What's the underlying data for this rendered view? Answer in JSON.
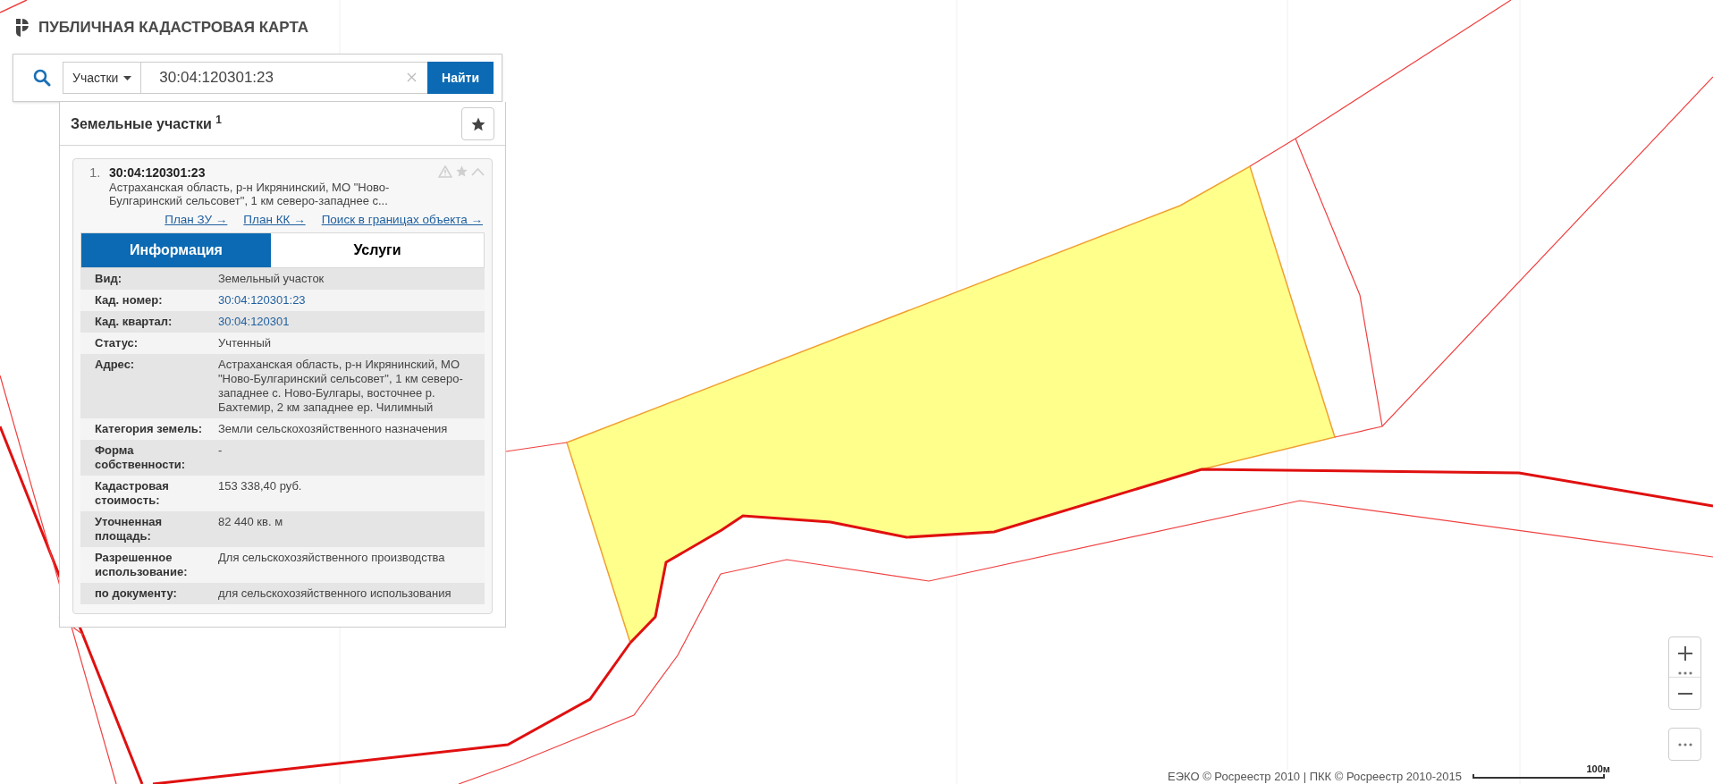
{
  "header": {
    "title": "ПУБЛИЧНАЯ КАДАСТРОВАЯ КАРТА"
  },
  "search": {
    "category": "Участки",
    "value": "30:04:120301:23",
    "button": "Найти"
  },
  "results": {
    "title": "Земельные участки $^{1}$",
    "items": [
      {
        "index": "1.",
        "number": "30:04:120301:23",
        "address": "Астраханская область, р-н Икрянинский, МО \"Ново-Булгаринский сельсовет\", 1 км северо-западнее с...",
        "links": [
          "План ЗУ →",
          "План КК →",
          "Поиск в границах объекта →"
        ],
        "tabs": [
          {
            "label": "Информация",
            "selected": true
          },
          {
            "label": "Услуги",
            "selected": false
          }
        ],
        "rows": [
          {
            "label": "Вид:",
            "value": "Земельный участок",
            "kind": "text"
          },
          {
            "label": "Кад. номер:",
            "value": "30:04:120301:23",
            "kind": "link"
          },
          {
            "label": "Кад. квартал:",
            "value": "30:04:120301",
            "kind": "link"
          },
          {
            "label": "Статус:",
            "value": "Учтенный",
            "kind": "text"
          },
          {
            "label": "Адрес:",
            "value": "Астраханская область, р-н Икрянинский, МО \"Ново-Булгаринский сельсовет\", 1 км северо-западнее с. Ново-Булгары, восточнее р. Бахтемир, 2 км западнее ер. Чилимный",
            "kind": "text"
          },
          {
            "label": "Категория земель:",
            "value": "Земли сельскохозяйственного назначения",
            "kind": "text"
          },
          {
            "label": "Форма собственности:",
            "value": "-",
            "kind": "text"
          },
          {
            "label": "Кадастровая стоимость:",
            "value": "153 338,40 руб.",
            "kind": "text"
          },
          {
            "label": "Уточненная площадь:",
            "value": "82 440 кв. м",
            "kind": "text"
          },
          {
            "label": "Разрешенное использование:",
            "value": "Для сельскохозяйственного производства",
            "kind": "text"
          },
          {
            "label": "по документу:",
            "value": "для сельскохозяйственного использования",
            "kind": "text"
          }
        ]
      }
    ]
  },
  "footer": {
    "attribution": "ЕЭКО © Росреестр 2010 | ПКК © Росреестр 2010-2015",
    "scale": "100м"
  }
}
